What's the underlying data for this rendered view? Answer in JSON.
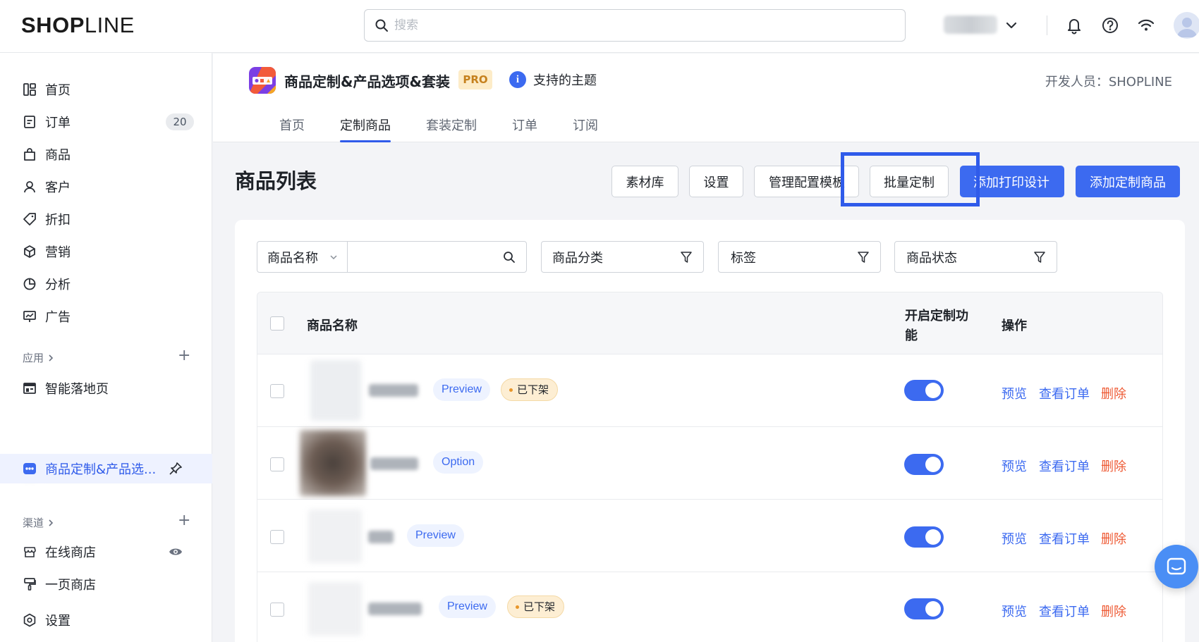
{
  "topbar": {
    "logo_bold": "SH",
    "logo_o": "O",
    "logo_p": "P",
    "logo_rest": "LINE",
    "search_placeholder": "搜索",
    "shop_name": "mockshop"
  },
  "sidebar": {
    "items": [
      {
        "label": "首页",
        "icon": "dashboard-icon"
      },
      {
        "label": "订单",
        "icon": "order-icon",
        "badge": "20"
      },
      {
        "label": "商品",
        "icon": "bag-icon"
      },
      {
        "label": "客户",
        "icon": "user-icon"
      },
      {
        "label": "折扣",
        "icon": "tag-icon"
      },
      {
        "label": "营销",
        "icon": "cube-icon"
      },
      {
        "label": "分析",
        "icon": "pie-chart-icon"
      },
      {
        "label": "广告",
        "icon": "ad-monitor-icon"
      }
    ],
    "apps_section": "应用",
    "apps": [
      {
        "label": "智能落地页",
        "icon": "layout-icon"
      },
      {
        "label": "商品定制&产品选...",
        "icon": "app-icon",
        "active": true
      }
    ],
    "channels_section": "渠道",
    "channels": [
      {
        "label": "在线商店",
        "icon": "store-icon"
      },
      {
        "label": "一页商店",
        "icon": "brush-icon"
      }
    ],
    "settings": "设置"
  },
  "app_header": {
    "title": "商品定制&产品选项&套装",
    "pro": "PRO",
    "themes_link": "支持的主题",
    "developer": "开发人员：SHOPLINE",
    "tabs": [
      "首页",
      "定制商品",
      "套装定制",
      "订单",
      "订阅"
    ],
    "active_tab": "定制商品"
  },
  "page": {
    "title": "商品列表",
    "buttons": {
      "material": "素材库",
      "settings": "设置",
      "manage_templates": "管理配置模板",
      "bulk_customize": "批量定制",
      "add_print_design": "添加打印设计",
      "add_custom_product": "添加定制商品"
    }
  },
  "filters": {
    "field_select": "商品名称",
    "search_value": "",
    "category": "商品分类",
    "tags": "标签",
    "status": "商品状态"
  },
  "table": {
    "headers": {
      "name": "商品名称",
      "enable_line1": "开启定制功",
      "enable_line2": "能",
      "actions": "操作"
    },
    "rows": [
      {
        "tag": "Preview",
        "status": "已下架",
        "enabled": true
      },
      {
        "tag": "Option",
        "status": "",
        "enabled": true
      },
      {
        "tag": "Preview",
        "status": "",
        "enabled": true
      },
      {
        "tag": "Preview",
        "status": "已下架",
        "enabled": true
      }
    ],
    "actions": {
      "preview": "预览",
      "view_orders": "查看订单",
      "delete": "删除"
    }
  },
  "colors": {
    "primary": "#3c6af0",
    "danger": "#ee5a34",
    "highlight_box": "#2f5bea",
    "pro_bg": "#fdecc8",
    "offline_bg": "#fdeed3"
  }
}
